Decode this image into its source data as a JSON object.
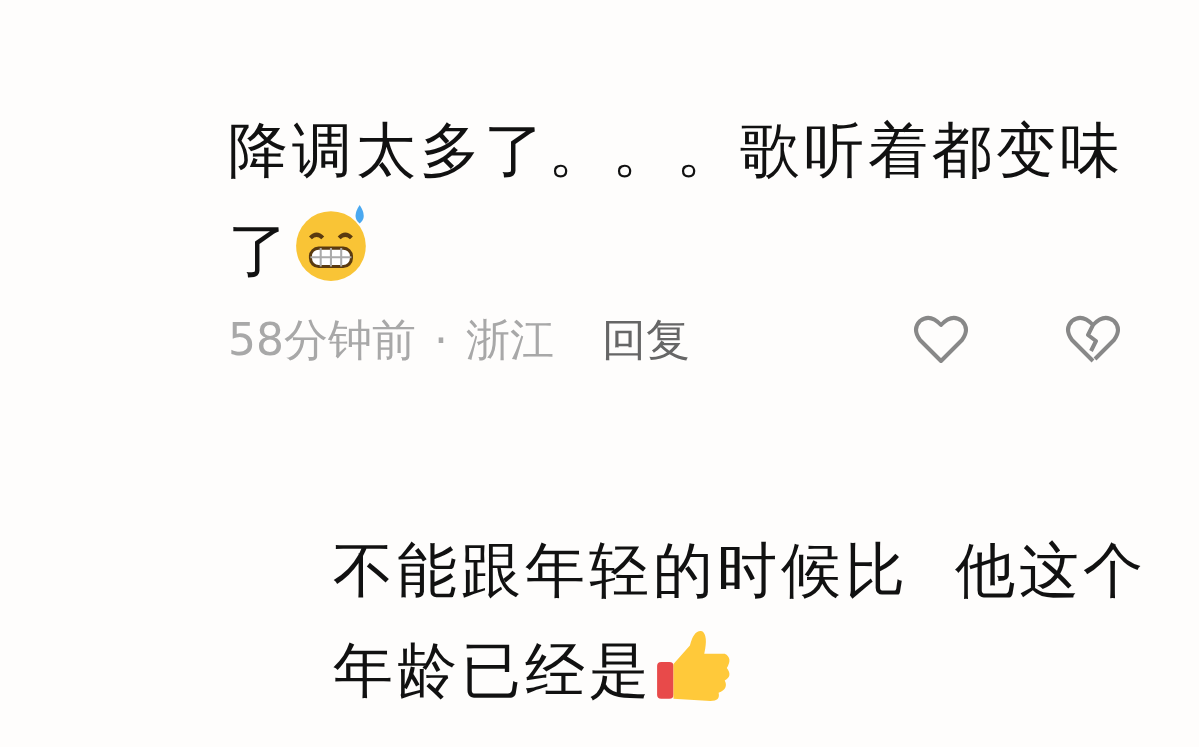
{
  "comments": [
    {
      "text": "降调太多了。。。歌听着都变味了",
      "emoji": {
        "kind": "sweat-grin"
      },
      "time": "58分钟前",
      "separator": "·",
      "location": "浙江",
      "reply": "回复",
      "liked": false,
      "disliked": false,
      "kind": "comment"
    },
    {
      "text": "不能跟年轻的时候比  他这个年龄已经是",
      "emoji": {
        "kind": "thumbs-up"
      },
      "kind": "reply"
    }
  ]
}
